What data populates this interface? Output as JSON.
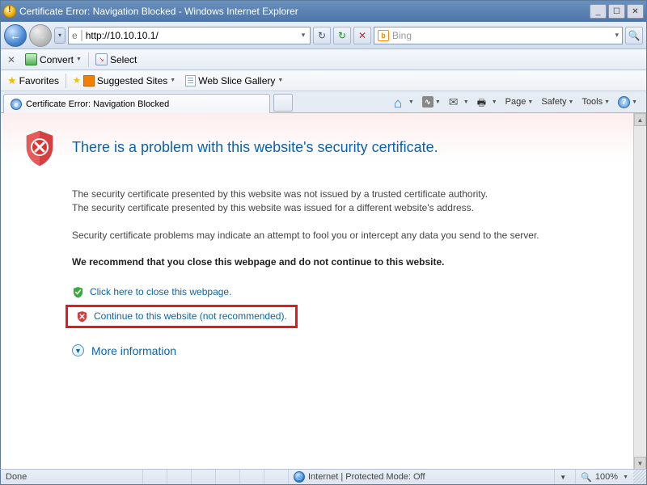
{
  "window": {
    "title": "Certificate Error: Navigation Blocked - Windows Internet Explorer"
  },
  "nav": {
    "url_proto_icon": "e",
    "url": "http://10.10.10.1/",
    "search_engine": "Bing",
    "search_placeholder": ""
  },
  "toolbar2": {
    "convert": "Convert",
    "select": "Select"
  },
  "favbar": {
    "favorites": "Favorites",
    "suggested": "Suggested Sites",
    "webslice": "Web Slice Gallery"
  },
  "tab": {
    "label": "Certificate Error: Navigation Blocked"
  },
  "cmdbar": {
    "page": "Page",
    "safety": "Safety",
    "tools": "Tools"
  },
  "content": {
    "heading": "There is a problem with this website's security certificate.",
    "para1a": "The security certificate presented by this website was not issued by a trusted certificate authority.",
    "para1b": "The security certificate presented by this website was issued for a different website's address.",
    "para2": "Security certificate problems may indicate an attempt to fool you or intercept any data you send to the server.",
    "recommend": "We recommend that you close this webpage and do not continue to this website.",
    "close_link": "Click here to close this webpage.",
    "continue_link": "Continue to this website (not recommended).",
    "more_info": "More information"
  },
  "status": {
    "done": "Done",
    "zone": "Internet | Protected Mode: Off",
    "zoom": "100%"
  }
}
